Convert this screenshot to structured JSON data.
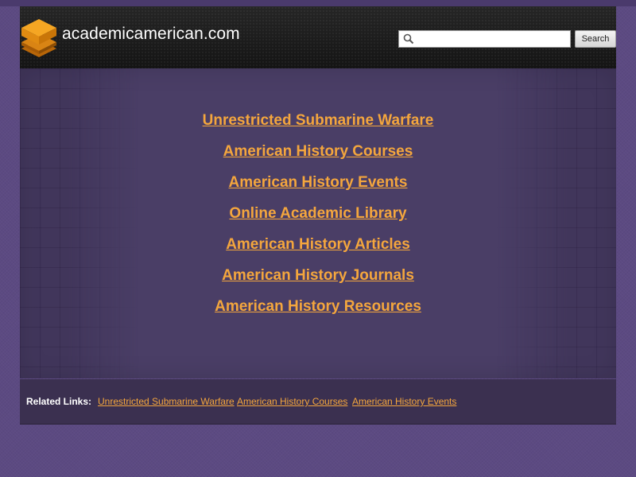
{
  "header": {
    "site_name": "academicamerican.com",
    "logo_icon": "hexagon-stack-icon",
    "search": {
      "placeholder": "",
      "value": "",
      "button_label": "Search"
    }
  },
  "main_links": [
    "Unrestricted Submarine Warfare",
    "American History Courses",
    "American History Events",
    "Online Academic Library",
    "American History Articles",
    "American History Journals",
    "American History Resources"
  ],
  "related": {
    "label": "Related Links:",
    "links": [
      "Unrestricted Submarine Warfare",
      "American History Courses",
      "American History Events"
    ]
  },
  "colors": {
    "link": "#f4a63d",
    "background": "#5c4a82",
    "header": "#1e1e1e",
    "panel": "#4a3e66",
    "related_bar": "#3b3050"
  }
}
